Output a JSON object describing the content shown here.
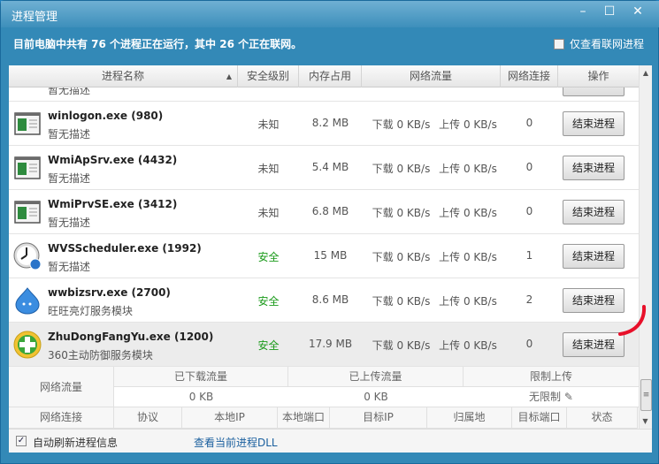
{
  "window": {
    "title": "进程管理",
    "minimize": "–",
    "maximize": "☐",
    "close": "✕"
  },
  "info": {
    "text": "目前电脑中共有 76 个进程正在运行，其中 26 个正在联网。",
    "only_network_label": "仅查看联网进程",
    "only_network_checked": false
  },
  "columns": {
    "name": "进程名称",
    "sort": "▲",
    "safety": "安全级别",
    "memory": "内存占用",
    "network": "网络流量",
    "connections": "网络连接",
    "action": "操作"
  },
  "partial_row": {
    "desc": "暂无描述"
  },
  "processes": [
    {
      "name": "winlogon.exe",
      "pid": "(980)",
      "desc": "暂无描述",
      "safety": "未知",
      "safe": false,
      "memory": "8.2 MB",
      "down": "下载 0 KB/s",
      "up": "上传 0 KB/s",
      "conn": "0",
      "action": "结束进程",
      "icon": "window-icon"
    },
    {
      "name": "WmiApSrv.exe",
      "pid": "(4432)",
      "desc": "暂无描述",
      "safety": "未知",
      "safe": false,
      "memory": "5.4 MB",
      "down": "下载 0 KB/s",
      "up": "上传 0 KB/s",
      "conn": "0",
      "action": "结束进程",
      "icon": "window-icon"
    },
    {
      "name": "WmiPrvSE.exe",
      "pid": "(3412)",
      "desc": "暂无描述",
      "safety": "未知",
      "safe": false,
      "memory": "6.8 MB",
      "down": "下载 0 KB/s",
      "up": "上传 0 KB/s",
      "conn": "0",
      "action": "结束进程",
      "icon": "window-icon"
    },
    {
      "name": "WVSScheduler.exe",
      "pid": "(1992)",
      "desc": "暂无描述",
      "safety": "安全",
      "safe": true,
      "memory": "15 MB",
      "down": "下载 0 KB/s",
      "up": "上传 0 KB/s",
      "conn": "1",
      "action": "结束进程",
      "icon": "clock-icon"
    },
    {
      "name": "wwbizsrv.exe",
      "pid": "(2700)",
      "desc": "旺旺亮灯服务模块",
      "safety": "安全",
      "safe": true,
      "memory": "8.6 MB",
      "down": "下载 0 KB/s",
      "up": "上传 0 KB/s",
      "conn": "2",
      "action": "结束进程",
      "icon": "wangwang-icon"
    },
    {
      "name": "ZhuDongFangYu.exe",
      "pid": "(1200)",
      "desc": "360主动防御服务模块",
      "safety": "安全",
      "safe": true,
      "memory": "17.9 MB",
      "down": "下载 0 KB/s",
      "up": "上传 0 KB/s",
      "conn": "0",
      "action": "结束进程",
      "icon": "360-icon",
      "selected": true
    }
  ],
  "detail": {
    "flow_label": "网络流量",
    "downloaded_label": "已下载流量",
    "uploaded_label": "已上传流量",
    "limit_label": "限制上传",
    "downloaded": "0 KB",
    "uploaded": "0 KB",
    "limit": "无限制",
    "conn_label": "网络连接",
    "conn_cols": [
      "协议",
      "本地IP",
      "本地端口",
      "目标IP",
      "归属地",
      "目标端口",
      "状态"
    ]
  },
  "footer": {
    "auto_refresh": "自动刷新进程信息",
    "auto_refresh_checked": true,
    "view_dll": "查看当前进程DLL"
  },
  "colors": {
    "accent": "#3389b7",
    "safe": "#1a9a1a",
    "link": "#1a5f9e",
    "annotation": "#e8102a"
  }
}
